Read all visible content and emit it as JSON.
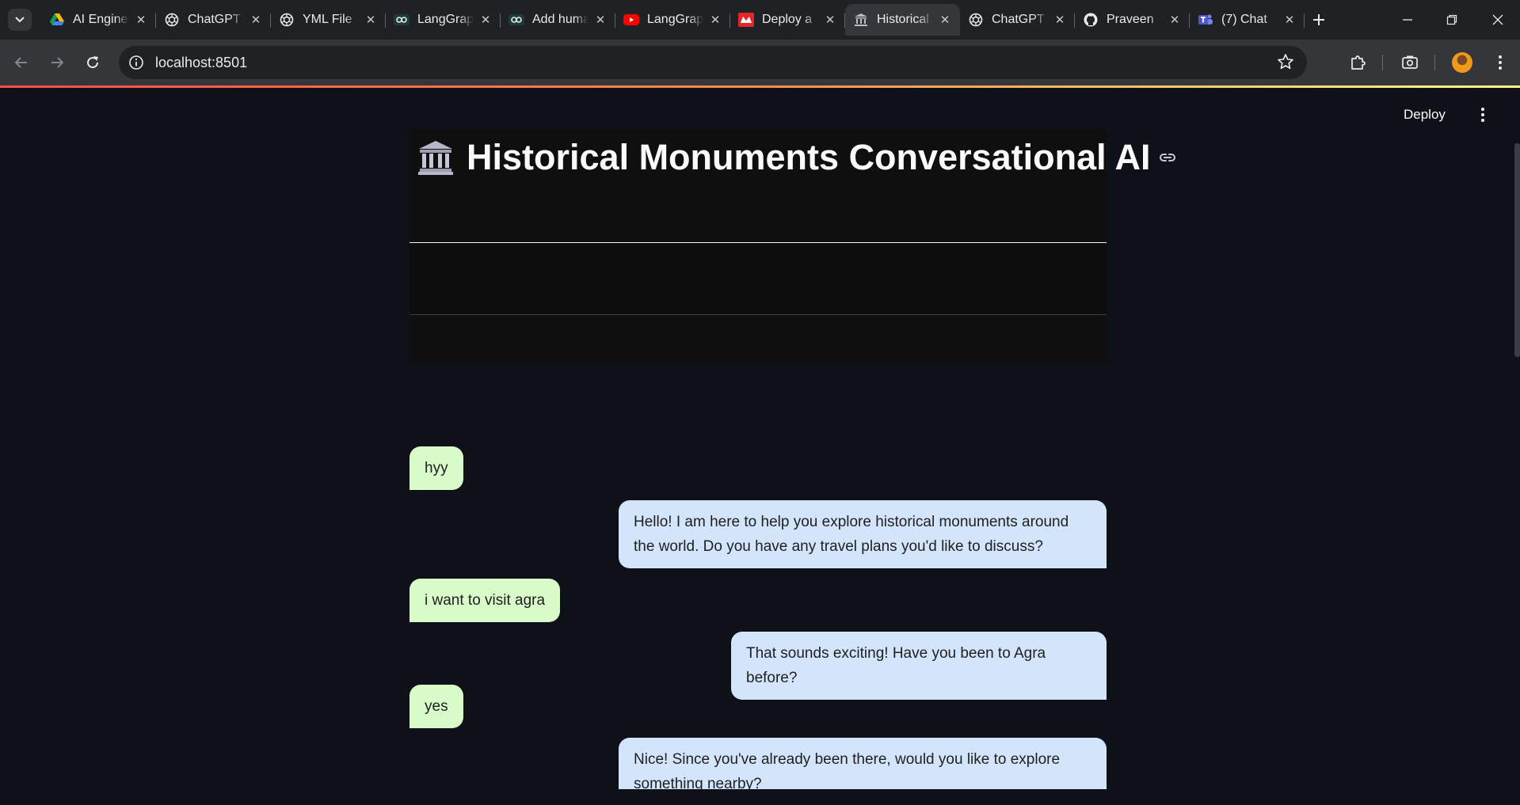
{
  "browser": {
    "tabs": [
      {
        "title": "AI Engineer",
        "icon": "google-drive-icon"
      },
      {
        "title": "ChatGPT",
        "icon": "openai-icon"
      },
      {
        "title": "YML File",
        "icon": "openai-icon"
      },
      {
        "title": "LangGraph",
        "icon": "langchain-icon"
      },
      {
        "title": "Add human",
        "icon": "langchain-icon"
      },
      {
        "title": "LangGraph",
        "icon": "youtube-icon"
      },
      {
        "title": "Deploy a",
        "icon": "streamlit-icon"
      },
      {
        "title": "Historical",
        "icon": "monument-icon",
        "active": true
      },
      {
        "title": "ChatGPT",
        "icon": "openai-icon"
      },
      {
        "title": "Praveen",
        "icon": "github-icon"
      },
      {
        "title": "(7) Chat",
        "icon": "teams-icon"
      }
    ],
    "url": "localhost:8501"
  },
  "app": {
    "deploy_label": "Deploy",
    "title": "Historical Monuments Conversational AI",
    "messages": [
      {
        "role": "user",
        "text": "hyy"
      },
      {
        "role": "assistant",
        "text": "Hello! I am here to help you explore historical monuments around the world. Do you have any travel plans you'd like to discuss?"
      },
      {
        "role": "user",
        "text": "i want to visit agra"
      },
      {
        "role": "assistant",
        "text": "That sounds exciting! Have you been to Agra before?"
      },
      {
        "role": "user",
        "text": "yes"
      },
      {
        "role": "assistant",
        "text": "Nice! Since you've already been there, would you like to explore something nearby?"
      }
    ]
  },
  "colors": {
    "app_background": "#0e1117",
    "user_bubble": "#d9fbc9",
    "assistant_bubble": "#d3e5fb",
    "accent_start": "#ff4b4b",
    "accent_end": "#fffd80"
  }
}
